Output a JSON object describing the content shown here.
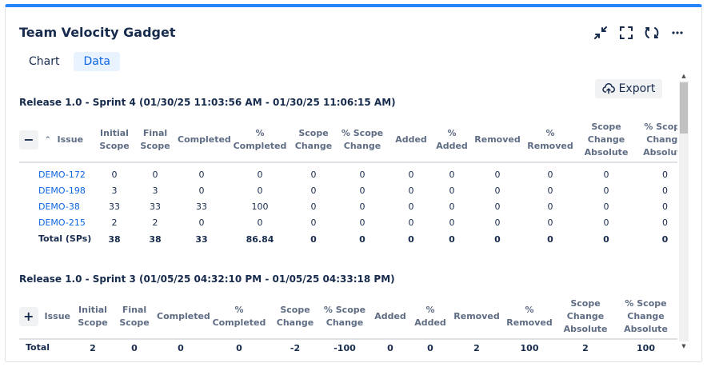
{
  "gadget": {
    "title": "Team Velocity Gadget",
    "actions": [
      {
        "name": "collapse-icon"
      },
      {
        "name": "fullscreen-icon"
      },
      {
        "name": "refresh-icon"
      },
      {
        "name": "more-icon"
      }
    ],
    "accent_color": "#2684ff"
  },
  "tabs": [
    {
      "label": "Chart",
      "active": false
    },
    {
      "label": "Data",
      "active": true
    }
  ],
  "export_label": "Export",
  "columns": [
    "Initial Scope",
    "Final Scope",
    "Completed",
    "% Completed",
    "Scope Change",
    "% Scope Change",
    "Added",
    "% Added",
    "Removed",
    "% Removed",
    "Scope Change Absolute",
    "% Scope Change Absolute"
  ],
  "issue_header": "Issue",
  "sprint1": {
    "title": "Release 1.0 - Sprint 4 (01/30/25 11:03:56 AM - 01/30/25 11:06:15 AM)",
    "toggle": "−",
    "rows": [
      {
        "issue": "DEMO-172",
        "values": [
          "0",
          "0",
          "0",
          "0",
          "0",
          "0",
          "0",
          "0",
          "0",
          "0",
          "0",
          "0"
        ]
      },
      {
        "issue": "DEMO-198",
        "values": [
          "3",
          "3",
          "0",
          "0",
          "0",
          "0",
          "0",
          "0",
          "0",
          "0",
          "0",
          "0"
        ]
      },
      {
        "issue": "DEMO-38",
        "values": [
          "33",
          "33",
          "33",
          "100",
          "0",
          "0",
          "0",
          "0",
          "0",
          "0",
          "0",
          "0"
        ]
      },
      {
        "issue": "DEMO-215",
        "values": [
          "2",
          "2",
          "0",
          "0",
          "0",
          "0",
          "0",
          "0",
          "0",
          "0",
          "0",
          "0"
        ]
      }
    ],
    "total": {
      "label": "Total (SPs)",
      "values": [
        "38",
        "38",
        "33",
        "86.84",
        "0",
        "0",
        "0",
        "0",
        "0",
        "0",
        "0",
        "0"
      ]
    }
  },
  "sprint2": {
    "title": "Release 1.0 - Sprint 3 (01/05/25 04:32:10 PM - 01/05/25 04:33:18 PM)",
    "toggle": "+",
    "total": {
      "label": "Total",
      "values": [
        "2",
        "0",
        "0",
        "0",
        "-2",
        "-100",
        "0",
        "0",
        "2",
        "100",
        "2",
        "100"
      ]
    }
  }
}
